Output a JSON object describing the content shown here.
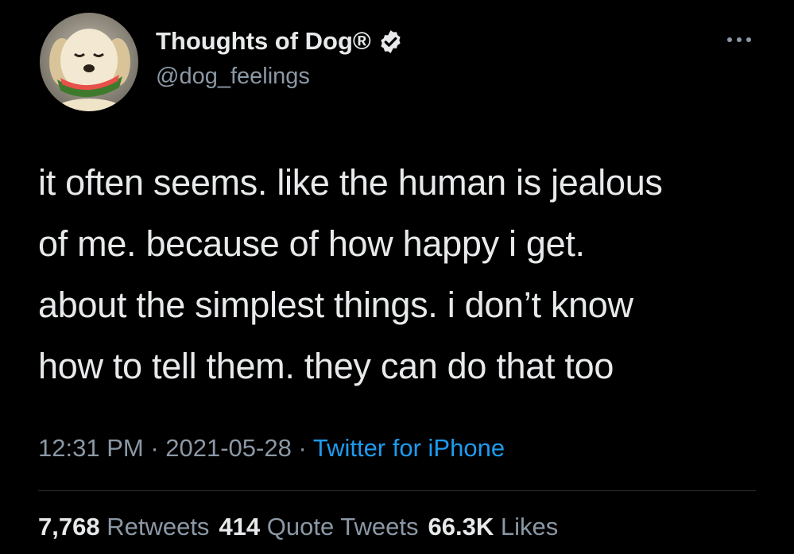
{
  "author": {
    "display_name": "Thoughts of Dog®",
    "handle": "@dog_feelings",
    "verified": true,
    "avatar_icon": "dog-with-watermelon-avatar"
  },
  "tweet": {
    "text_lines": [
      "it often seems. like the human is jealous",
      "of me. because of how happy i get.",
      "about the simplest things. i don’t know",
      "how to tell them. they can do that too"
    ]
  },
  "meta": {
    "time": "12:31 PM",
    "separator": " · ",
    "date": "2021-05-28",
    "source": "Twitter for iPhone"
  },
  "stats": {
    "retweets_count": "7,768",
    "retweets_label": "Retweets",
    "quotes_count": "414",
    "quotes_label": "Quote Tweets",
    "likes_count": "66.3K",
    "likes_label": "Likes"
  },
  "colors": {
    "background": "#000000",
    "primary_text": "#e7e9ea",
    "secondary_text": "#8b98a5",
    "link": "#1d9bf0",
    "divider": "#2f3336"
  },
  "icons": {
    "verified": "verified-badge-icon",
    "more": "more-options-icon"
  }
}
